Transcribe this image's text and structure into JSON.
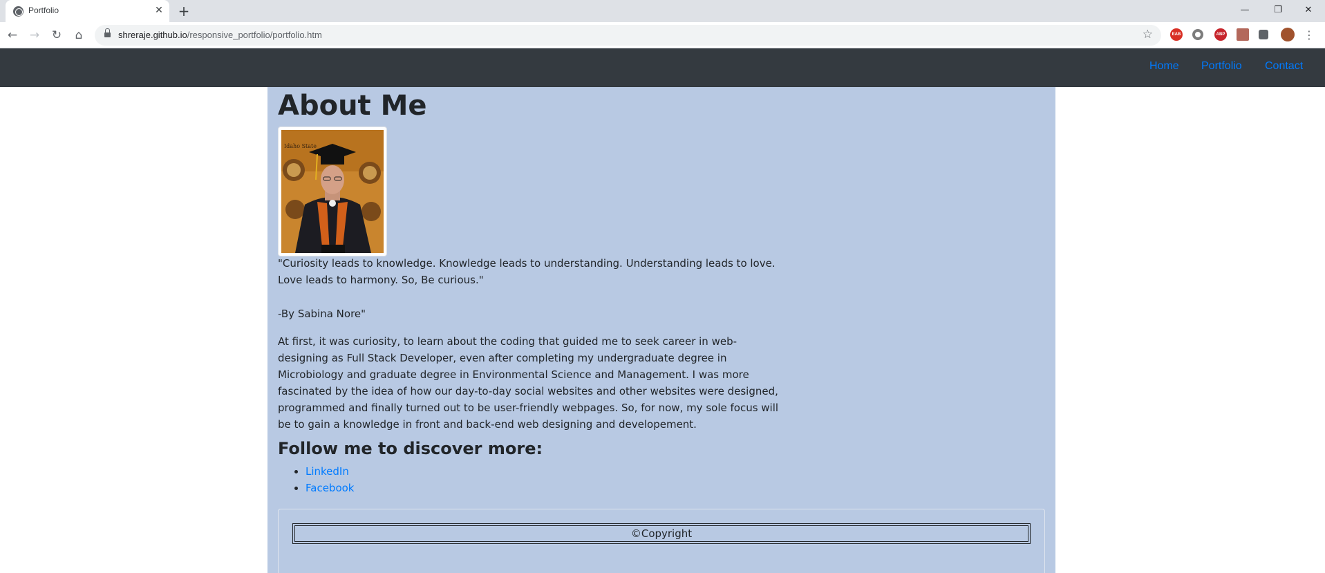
{
  "browser": {
    "tab_title": "Portfolio",
    "tab_close": "✕",
    "new_tab": "+",
    "url_host": "shreraje.github.io",
    "url_path": "/responsive_portfolio/portfolio.htm",
    "back": "←",
    "forward": "→",
    "reload": "↻",
    "home": "⌂",
    "star": "☆",
    "minimize": "—",
    "restore": "❐",
    "close": "✕",
    "menu": "⋮",
    "extensions": [
      {
        "name": "red-badge-extension-icon",
        "label": "EAB",
        "color": "#d93025"
      },
      {
        "name": "circle-extension-icon",
        "label": "",
        "color": "#7c7c7c"
      },
      {
        "name": "abp-extension-icon",
        "label": "ABP",
        "color": "#c7252c"
      },
      {
        "name": "pdf-extension-icon",
        "label": "",
        "color": "#b3685b"
      },
      {
        "name": "puzzle-extension-icon",
        "label": "",
        "color": "#5f6368"
      },
      {
        "name": "profile-avatar",
        "label": "",
        "color": "#a0522d"
      }
    ]
  },
  "nav": {
    "home": "Home",
    "portfolio": "Portfolio",
    "contact": "Contact",
    "link_color": "#007bff",
    "bg_color": "#343a40"
  },
  "about": {
    "heading": "About Me",
    "quote": "\"Curiosity leads to knowledge. Knowledge leads to understanding. Understanding leads to love. Love leads to harmony. So, Be curious.\"",
    "author": "-By Sabina Nore\"",
    "bio": "At first, it was curiosity, to learn about the coding that guided me to seek career in web-designing as Full Stack Developer, even after completing my undergraduate degree in Microbiology and graduate degree in Environmental Science and Management. I was more fascinated by the idea of how our day-to-day social websites and other websites were designed, programmed and finally turned out to be user-friendly webpages. So, for now, my sole focus will be to gain a knowledge in front and back-end web designing and developement.",
    "follow_heading": "Follow me to discover more:",
    "links": [
      "LinkedIn",
      "Facebook"
    ],
    "photo_banner": "Idaho State",
    "bg_color": "#b8c9e3"
  },
  "footer": {
    "copyright": "©Copyright"
  }
}
